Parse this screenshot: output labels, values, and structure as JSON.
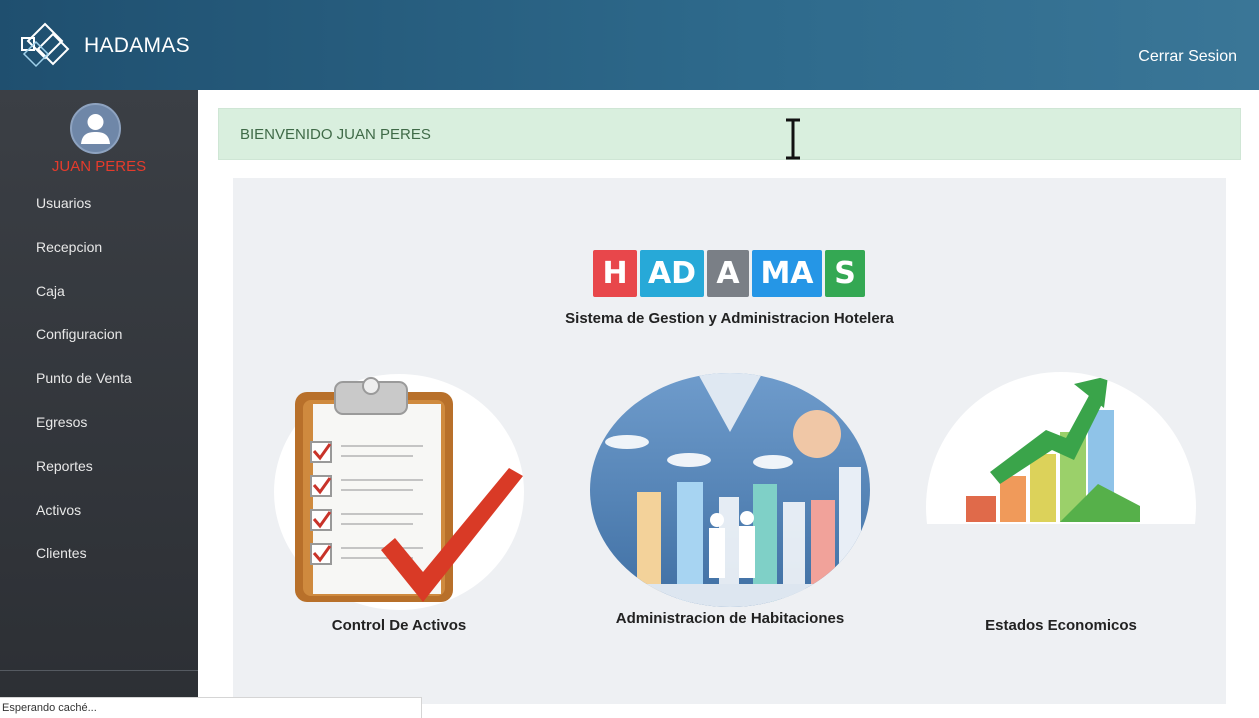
{
  "app": {
    "name": "HADAMAS",
    "logout_label": "Cerrar Sesion"
  },
  "user": {
    "name": "JUAN PERES"
  },
  "sidebar": {
    "items": [
      {
        "label": "Usuarios"
      },
      {
        "label": "Recepcion"
      },
      {
        "label": "Caja"
      },
      {
        "label": "Configuracion"
      },
      {
        "label": "Punto de Venta"
      },
      {
        "label": "Egresos"
      },
      {
        "label": "Reportes"
      },
      {
        "label": "Activos"
      },
      {
        "label": "Clientes"
      }
    ]
  },
  "welcome": {
    "text": "BIENVENIDO JUAN PERES"
  },
  "hero": {
    "tiles": [
      {
        "text": "H",
        "color": "#e8474b"
      },
      {
        "text": "AD",
        "color": "#27a9d8"
      },
      {
        "text": "A",
        "color": "#7a7f86"
      },
      {
        "text": "MA",
        "color": "#2596e6"
      },
      {
        "text": "S",
        "color": "#34a853"
      }
    ],
    "subtitle": "Sistema de Gestion y Administracion Hotelera"
  },
  "cards": [
    {
      "caption": "Control De Activos",
      "icon": "clipboard-checklist-icon"
    },
    {
      "caption": "Administracion de Habitaciones",
      "icon": "business-handshake-city-icon"
    },
    {
      "caption": "Estados Economicos",
      "icon": "growth-bar-chart-icon"
    }
  ],
  "status": {
    "text": "Esperando caché..."
  },
  "colors": {
    "topbar": "#2e6a8c",
    "sidebar": "#33373c",
    "username": "#e53b2c",
    "welcome_bg": "#d9efde"
  }
}
